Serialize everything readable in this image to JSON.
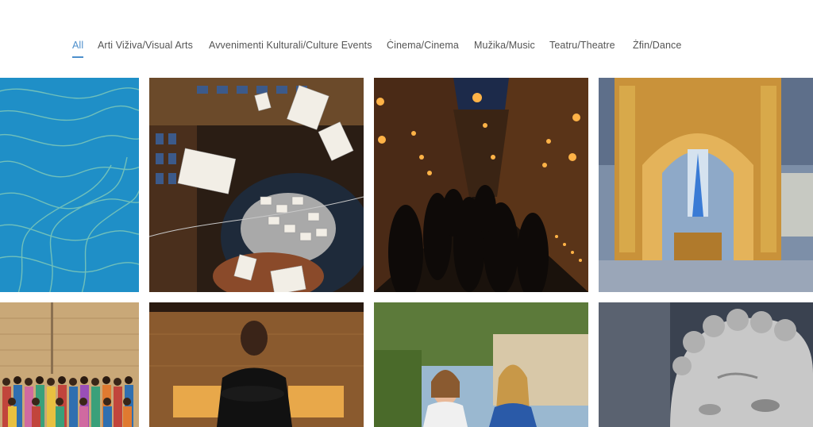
{
  "filters": [
    {
      "label": "All",
      "active": true
    },
    {
      "label": "Arti Viživa/Visual Arts",
      "active": false
    },
    {
      "label": "Avvenimenti Kulturali/Culture Events",
      "active": false
    },
    {
      "label": "Ċinema/Cinema",
      "active": false
    },
    {
      "label": "Mužika/Music",
      "active": false
    },
    {
      "label": "Teatru/Theatre",
      "active": false
    },
    {
      "label": "Żfin/Dance",
      "active": false
    }
  ],
  "colors": {
    "accent": "#4d8fcc",
    "filter_text": "#545454"
  }
}
